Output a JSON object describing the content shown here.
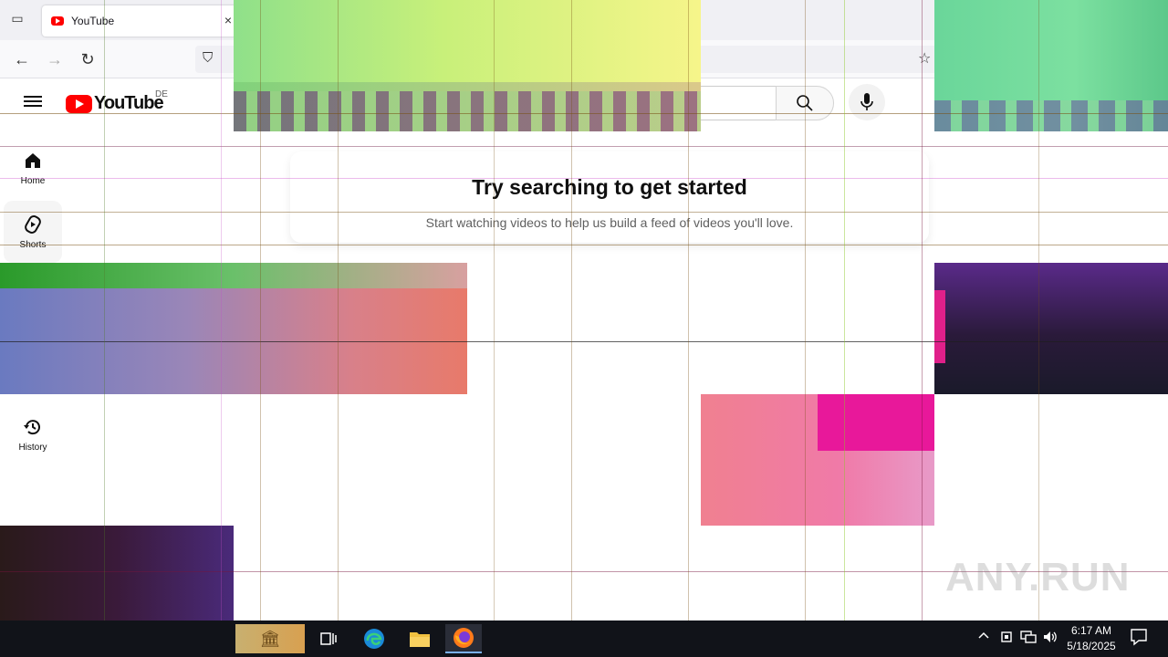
{
  "browser": {
    "tab_title": "YouTube",
    "tab_close": "×",
    "back_glyph": "←",
    "forward_glyph": "→",
    "reload_glyph": "↻",
    "shield_glyph": "⛉",
    "star_glyph": "☆"
  },
  "youtube": {
    "logo_text": "YouTube",
    "region": "DE",
    "sidebar": [
      {
        "label": "Home",
        "icon": "home-icon"
      },
      {
        "label": "Shorts",
        "icon": "shorts-icon"
      },
      {
        "label": "History",
        "icon": "history-icon"
      }
    ],
    "prompt_title": "Try searching to get started",
    "prompt_subtitle": "Start watching videos to help us build a feed of videos you'll love."
  },
  "taskbar": {
    "time": "6:17 AM",
    "date": "5/18/2025",
    "tray_chevron": "^"
  },
  "watermark": "ANY.RUN",
  "colors": {
    "brand_red": "#ff0000",
    "taskbar_bg": "#111319"
  }
}
